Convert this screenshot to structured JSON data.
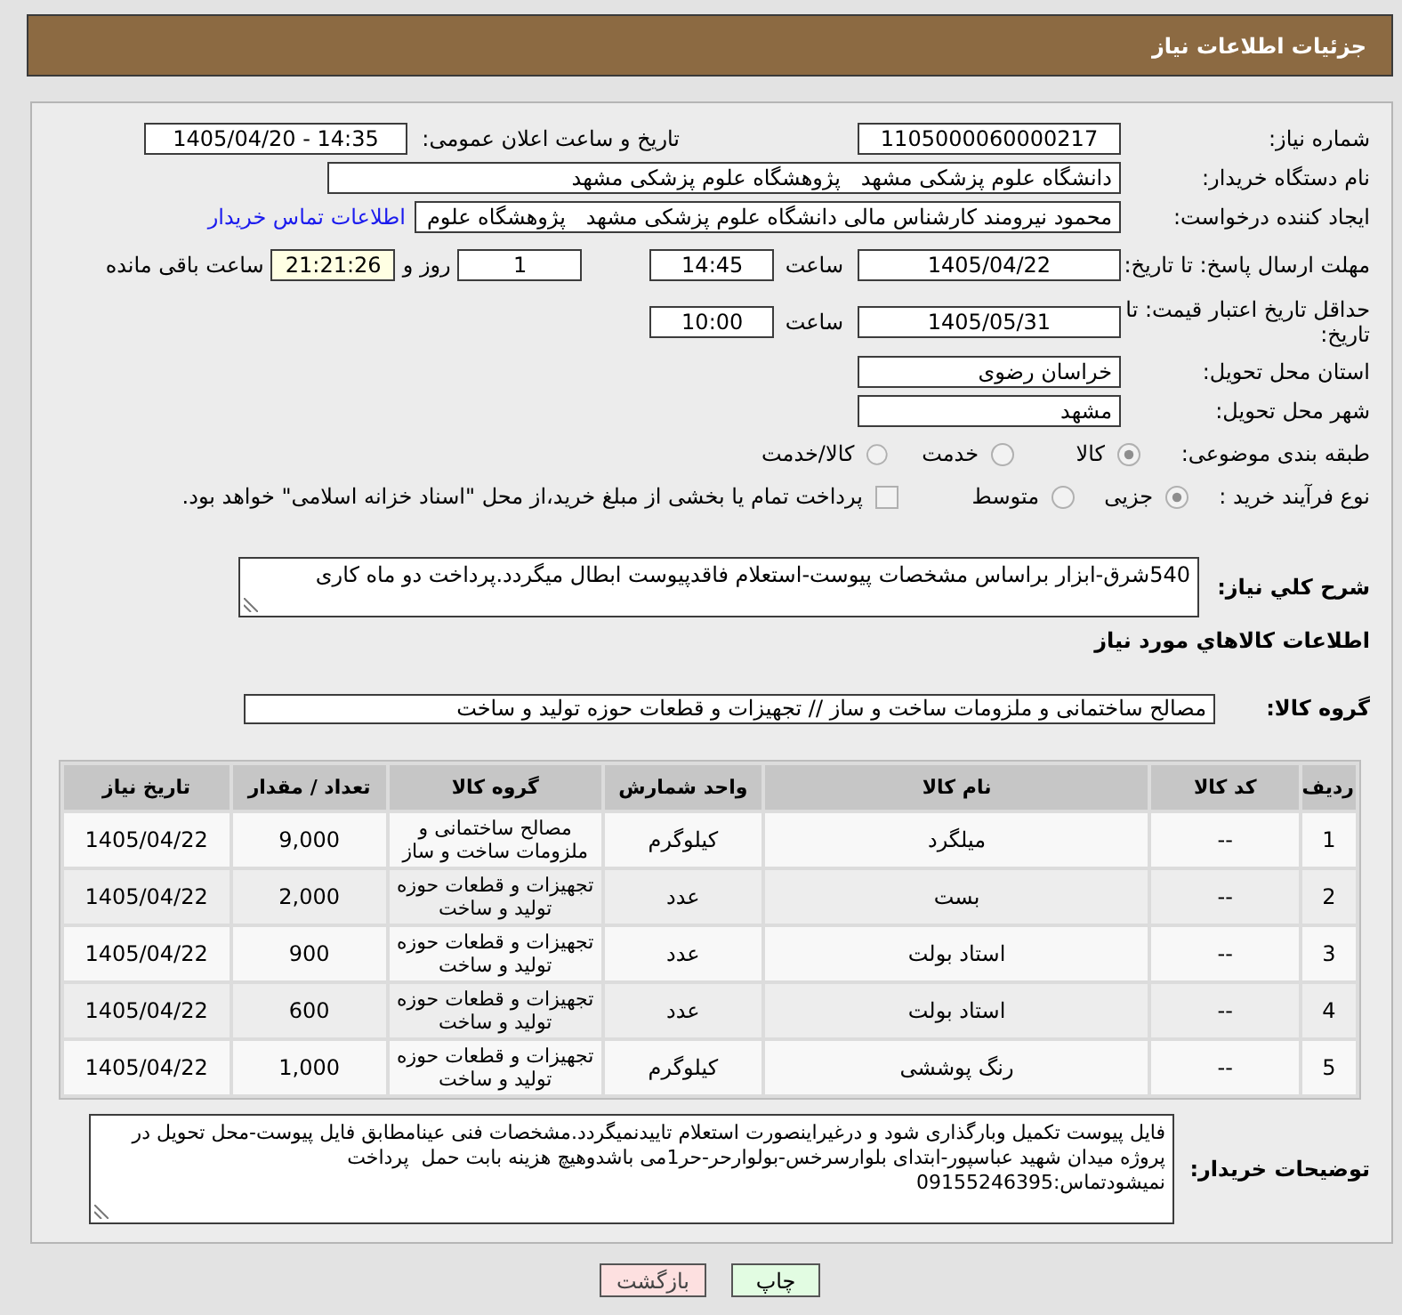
{
  "header": {
    "title": "جزئیات اطلاعات نیاز"
  },
  "details": {
    "need_number": {
      "label": "شماره نیاز:",
      "value": "1105000060000217"
    },
    "announce_datetime": {
      "label": "تاریخ و ساعت اعلان عمومی:",
      "value": "1405/04/20 - 14:35"
    },
    "buyer_org": {
      "label": "نام دستگاه خریدار:",
      "value": "دانشگاه علوم پزشکی مشهد   پژوهشگاه علوم پزشکی مشهد"
    },
    "requester": {
      "label": "ایجاد کننده درخواست:",
      "value": "محمود نیرومند کارشناس مالی دانشگاه علوم پزشکی مشهد   پژوهشگاه علوم",
      "link": "اطلاعات تماس خریدار"
    },
    "response_deadline": {
      "label": "مهلت ارسال پاسخ: تا تاریخ:",
      "date": "1405/04/22",
      "time_label": "ساعت",
      "time": "14:45",
      "days": "1",
      "days_label": "روز و",
      "remaining": "21:21:26",
      "remaining_label": "ساعت باقی مانده"
    },
    "price_validity": {
      "label": "حداقل تاریخ اعتبار قیمت: تا تاریخ:",
      "date": "1405/05/31",
      "time_label": "ساعت",
      "time": "10:00"
    },
    "province": {
      "label": "استان محل تحویل:",
      "value": "خراسان رضوی"
    },
    "city": {
      "label": "شهر محل تحویل:",
      "value": "مشهد"
    },
    "category": {
      "label": "طبقه بندی موضوعی:",
      "options": [
        {
          "label": "کالا",
          "selected": true
        },
        {
          "label": "خدمت",
          "selected": false
        },
        {
          "label": "کالا/خدمت",
          "selected": false
        }
      ]
    },
    "purchase_type": {
      "label": "نوع فرآیند خرید :",
      "options": [
        {
          "label": "جزیی",
          "selected": true
        },
        {
          "label": "متوسط",
          "selected": false
        }
      ],
      "treasury_payment": {
        "label": "پرداخت تمام یا بخشی از مبلغ خرید،از محل \"اسناد خزانه اسلامی\" خواهد بود.",
        "checked": false
      }
    }
  },
  "description": {
    "label": "شرح كلي نياز:",
    "text": "540شرق-ابزار براساس مشخصات پیوست-استعلام فاقدپیوست ابطال میگردد.پرداخت دو ماه کاری"
  },
  "goods_section": {
    "title": "اطلاعات كالاهاي مورد نياز",
    "group_label": "گروه کالا:",
    "group_value": "مصالح ساختمانی و ملزومات ساخت و ساز // تجهیزات و قطعات حوزه تولید و ساخت"
  },
  "items_table": {
    "columns": [
      "ردیف",
      "کد کالا",
      "نام کالا",
      "واحد شمارش",
      "گروه کالا",
      "تعداد / مقدار",
      "تاریخ نیاز"
    ],
    "rows": [
      [
        "1",
        "--",
        "میلگرد",
        "کیلوگرم",
        "مصالح ساختمانی و ملزومات ساخت و ساز",
        "9,000",
        "1405/04/22"
      ],
      [
        "2",
        "--",
        "بست",
        "عدد",
        "تجهیزات و قطعات حوزه تولید و ساخت",
        "2,000",
        "1405/04/22"
      ],
      [
        "3",
        "--",
        "استاد بولت",
        "عدد",
        "تجهیزات و قطعات حوزه تولید و ساخت",
        "900",
        "1405/04/22"
      ],
      [
        "4",
        "--",
        "استاد بولت",
        "عدد",
        "تجهیزات و قطعات حوزه تولید و ساخت",
        "600",
        "1405/04/22"
      ],
      [
        "5",
        "--",
        "رنگ پوششی",
        "کیلوگرم",
        "تجهیزات و قطعات حوزه تولید و ساخت",
        "1,000",
        "1405/04/22"
      ]
    ]
  },
  "buyer_notes": {
    "label": "توضیحات خریدار:",
    "text": "فایل پیوست تکمیل وبارگذاری شود و درغیراینصورت استعلام تاییدنمیگردد.مشخصات فنی عینامطابق فایل پیوست-محل تحویل در پروژه میدان شهید عباسپور-ابتدای بلوارسرخس-بولوارحر-حر1می باشدوهیچ هزینه بابت حمل  پرداخت نمیشودتماس:09155246395"
  },
  "buttons": [
    {
      "label": "چاپ",
      "kind": "print"
    },
    {
      "label": "بازگشت",
      "kind": "back"
    }
  ]
}
